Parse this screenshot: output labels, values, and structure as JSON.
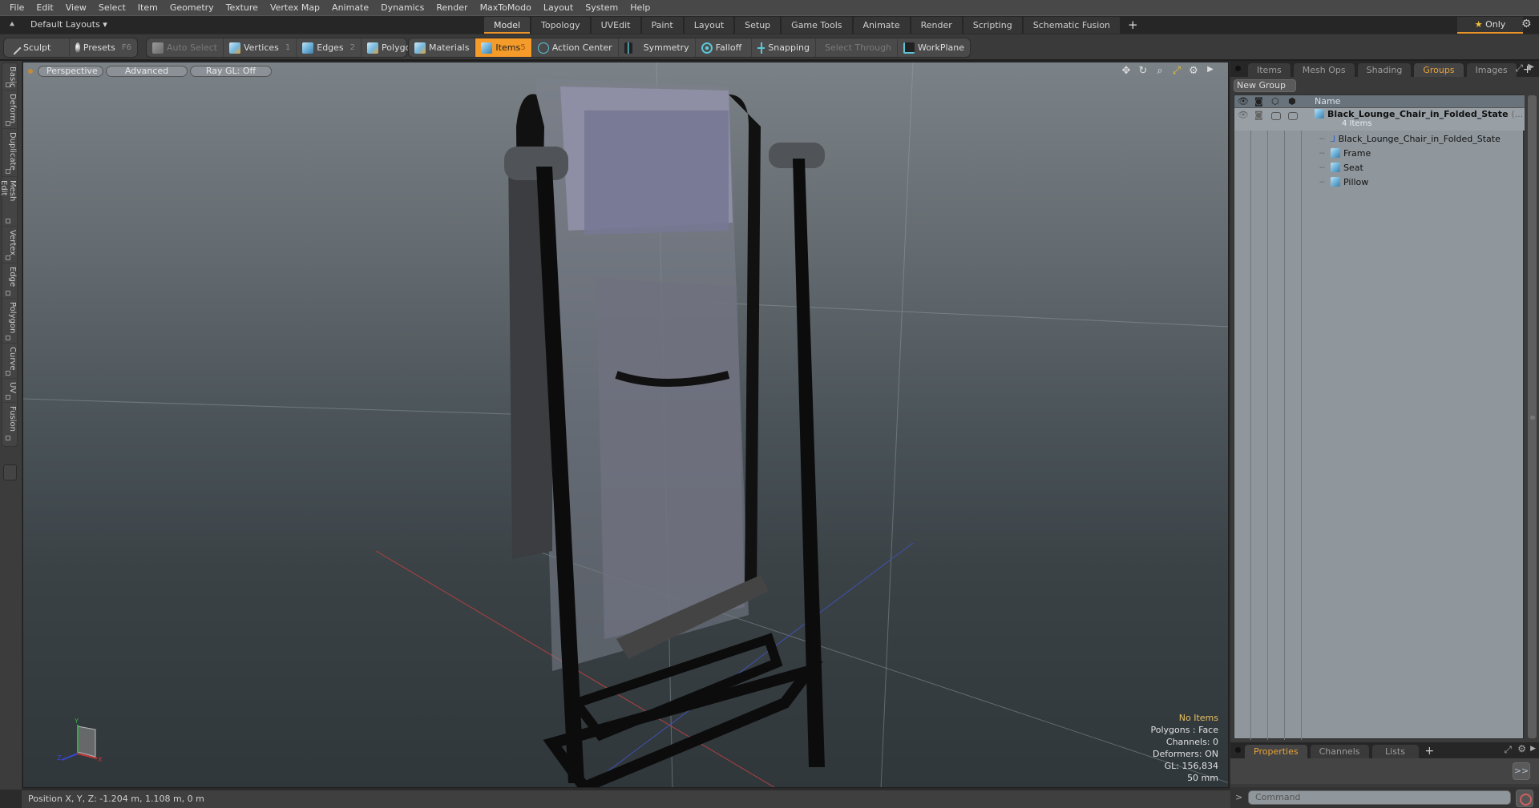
{
  "menu": [
    "File",
    "Edit",
    "View",
    "Select",
    "Item",
    "Geometry",
    "Texture",
    "Vertex Map",
    "Animate",
    "Dynamics",
    "Render",
    "MaxToModo",
    "Layout",
    "System",
    "Help"
  ],
  "layout_bar": {
    "layout_select": "Default Layouts ▾",
    "tabs": [
      {
        "label": "Model",
        "active": true
      },
      {
        "label": "Topology"
      },
      {
        "label": "UVEdit"
      },
      {
        "label": "Paint"
      },
      {
        "label": "Layout"
      },
      {
        "label": "Setup"
      },
      {
        "label": "Game Tools"
      },
      {
        "label": "Animate"
      },
      {
        "label": "Render"
      },
      {
        "label": "Scripting"
      },
      {
        "label": "Schematic Fusion"
      }
    ],
    "add_tab": "+",
    "only_label": "Only",
    "star": "★"
  },
  "toolbar": {
    "sculpt": "Sculpt",
    "presets": "Presets",
    "presets_key": "F6",
    "auto_select": "Auto Select",
    "vertices": "Vertices",
    "vertices_key": "1",
    "edges": "Edges",
    "edges_key": "2",
    "polygons": "Polygons",
    "materials": "Materials",
    "items": "Items",
    "items_key": "5",
    "action_center": "Action Center",
    "symmetry": "Symmetry",
    "falloff": "Falloff",
    "snapping": "Snapping",
    "select_through": "Select Through",
    "workplane": "WorkPlane"
  },
  "left_tabs": [
    "Basic",
    "Deform",
    "Duplicate",
    "Mesh Edit",
    "Vertex",
    "Edge",
    "Polygon",
    "Curve",
    "UV",
    "Fusion"
  ],
  "viewport": {
    "view_mode": "Perspective",
    "shading": "Advanced",
    "raygl": "Ray GL: Off",
    "info": {
      "selection": "No Items",
      "polygons": "Polygons : Face",
      "channels": "Channels: 0",
      "deformers": "Deformers: ON",
      "gl": "GL: 156,834",
      "focal": "50 mm"
    },
    "axis_labels": {
      "x": "X",
      "y": "Y",
      "z": "Z"
    }
  },
  "right_panel": {
    "tabs": [
      {
        "label": "Items"
      },
      {
        "label": "Mesh Ops"
      },
      {
        "label": "Shading"
      },
      {
        "label": "Groups",
        "active": true
      },
      {
        "label": "Images"
      }
    ],
    "add_tab": "+",
    "new_group": "New Group",
    "column_name": "Name",
    "tree": {
      "root": {
        "label": "Black_Lounge_Chair_in_Folded_State",
        "suffix": "(...",
        "count": "4 Items"
      },
      "children": [
        {
          "label": "Black_Lounge_Chair_in_Folded_State",
          "icon": "locator-icon"
        },
        {
          "label": "Frame",
          "icon": "mesh-icon"
        },
        {
          "label": "Seat",
          "icon": "mesh-icon"
        },
        {
          "label": "Pillow",
          "icon": "mesh-icon"
        }
      ]
    }
  },
  "properties": {
    "tabs": [
      {
        "label": "Properties",
        "active": true
      },
      {
        "label": "Channels"
      },
      {
        "label": "Lists"
      }
    ],
    "add_tab": "+",
    "expand": ">>"
  },
  "command": {
    "prompt": ">",
    "placeholder": "Command"
  },
  "status": {
    "position": "Position X, Y, Z:   -1.204 m, 1.108 m, 0 m"
  },
  "colors": {
    "accent": "#f59b2a",
    "active_tab_text": "#e8a23a",
    "info_highlight": "#e8c060"
  }
}
